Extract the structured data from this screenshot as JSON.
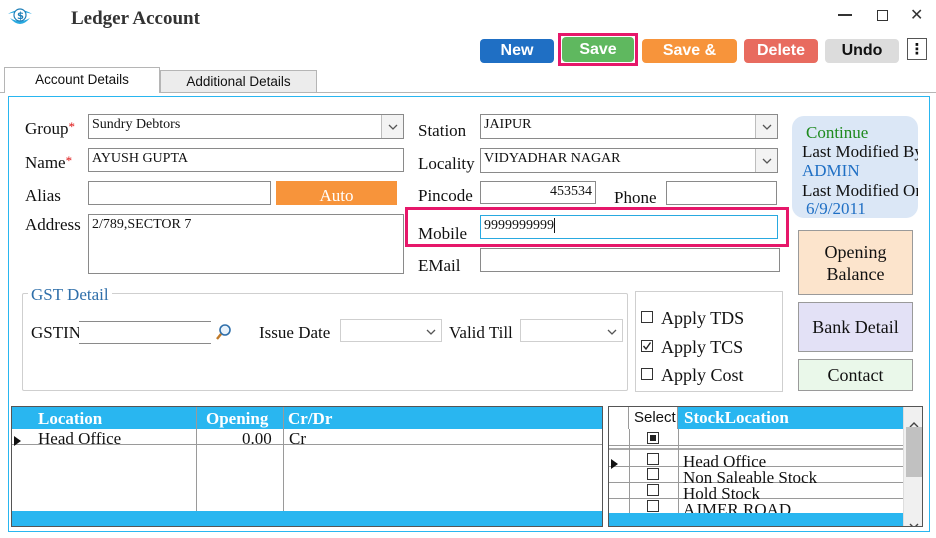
{
  "window": {
    "title": "Ledger Account",
    "minimize": "—",
    "maximize": "☐",
    "close": "✕"
  },
  "toolbar": {
    "new_label": "New",
    "save_label": "Save",
    "save_and_label": "Save &",
    "delete_label": "Delete",
    "undo_label": "Undo",
    "more": "⋮"
  },
  "tabs": [
    {
      "label": "Account Details"
    },
    {
      "label": "Additional Details"
    }
  ],
  "form": {
    "group_label": "Group",
    "group_value": "Sundry Debtors",
    "name_label": "Name",
    "name_value": "AYUSH GUPTA",
    "alias_label": "Alias",
    "alias_value": "",
    "auto_label": "Auto",
    "address_label": "Address",
    "address_value": "2/789,SECTOR 7",
    "station_label": "Station",
    "station_value": "JAIPUR",
    "locality_label": "Locality",
    "locality_value": "VIDYADHAR NAGAR",
    "pincode_label": "Pincode",
    "pincode_value": "453534",
    "phone_label": "Phone",
    "phone_value": "",
    "mobile_label": "Mobile",
    "mobile_value": "9999999999",
    "email_label": "EMail",
    "email_value": "",
    "required_mark": "*"
  },
  "info": {
    "continue": "Continue",
    "last_modified_1": "Last Modified By",
    "modified_by": "ADMIN",
    "last_modified_2": "Last Modified On",
    "modified_on": "6/9/2011"
  },
  "gst": {
    "legend": "GST Detail",
    "gstin_label": "GSTIN",
    "gstin_value": "",
    "issue_date_label": "Issue Date",
    "valid_till_label": "Valid Till"
  },
  "options": [
    {
      "label": "Apply TDS",
      "checked": false
    },
    {
      "label": "Apply TCS",
      "checked": true
    },
    {
      "label": "Apply Cost",
      "checked": false
    }
  ],
  "side_buttons": {
    "opening_balance": "Opening Balance",
    "bank_detail": "Bank Detail",
    "contact": "Contact"
  },
  "location_grid": {
    "columns": [
      "Location",
      "Opening",
      "Cr/Dr"
    ],
    "rows": [
      {
        "location": "Head Office",
        "opening": "0.00",
        "crdr": "Cr"
      }
    ]
  },
  "stock_grid": {
    "columns": [
      "Select",
      "StockLocation"
    ],
    "rows": [
      {
        "name": "Head Office"
      },
      {
        "name": "Non Saleable Stock"
      },
      {
        "name": "Hold Stock"
      },
      {
        "name": "AJMER ROAD"
      }
    ]
  },
  "colors": {
    "new": "#1f6fc4",
    "save": "#5fb85f",
    "save_and": "#f7943b",
    "delete": "#e86b5f",
    "undo": "#dcdcdc",
    "accent": "#29b6f0",
    "highlight": "#e6176a"
  }
}
